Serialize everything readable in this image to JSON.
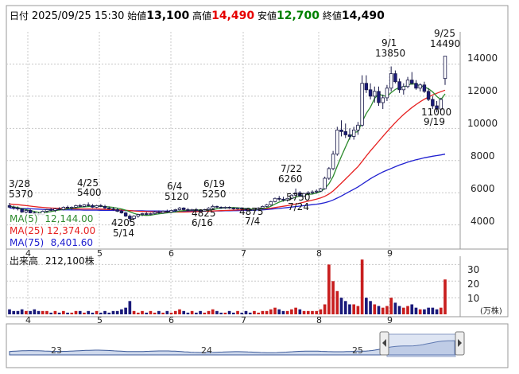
{
  "header": {
    "date_label": "日付",
    "datetime": "2025/09/25 15:30",
    "open_label": "始値",
    "open_value": "13,100",
    "high_label": "高値",
    "high_value": "14,490",
    "low_label": "安値",
    "low_value": "12,700",
    "close_label": "終値",
    "close_value": "14,490"
  },
  "colors": {
    "up": "#ffffff",
    "down": "#1a1a7a",
    "ma5": "#2e8b2e",
    "ma25": "#e62020",
    "ma75": "#2020d0",
    "volume": "#c81e1e",
    "grid": "#c8c8c8"
  },
  "legend": {
    "ma5_label": "MA(5)",
    "ma5_value": "12,144.00",
    "ma25_label": "MA(25)",
    "ma25_value": "12,374.00",
    "ma75_label": "MA(75)",
    "ma75_value": "8,401.60"
  },
  "volume_panel": {
    "label": "出来高",
    "value": "212,100株",
    "unit": "(万株)",
    "ticks": [
      "30",
      "20",
      "10"
    ]
  },
  "price_ticks": [
    "14000",
    "12000",
    "10000",
    "8000",
    "6000",
    "4000"
  ],
  "month_labels": [
    "4",
    "5",
    "6",
    "7",
    "8",
    "9"
  ],
  "navigator": {
    "labels": [
      "23",
      "24",
      "25"
    ]
  },
  "annotations": [
    {
      "date": "3/28",
      "value": "5370"
    },
    {
      "date": "4/25",
      "value": "5400"
    },
    {
      "date": "5/14",
      "value": "4205"
    },
    {
      "date": "6/4",
      "value": "5120"
    },
    {
      "date": "6/16",
      "value": "4825"
    },
    {
      "date": "6/19",
      "value": "5250"
    },
    {
      "date": "7/4",
      "value": "4875"
    },
    {
      "date": "7/22",
      "value": "6260"
    },
    {
      "date": "7/24",
      "value": "5750"
    },
    {
      "date": "9/1",
      "value": "13850"
    },
    {
      "date": "9/19",
      "value": "11000"
    },
    {
      "date": "9/25",
      "value": "14490"
    }
  ],
  "chart_data": {
    "type": "candlestick",
    "ylim": [
      2500,
      16000
    ],
    "volume_ylim": [
      0,
      35
    ],
    "candles": [
      {
        "o": 5200,
        "h": 5370,
        "l": 5050,
        "c": 5100,
        "v": 3
      },
      {
        "o": 5100,
        "h": 5200,
        "l": 4950,
        "c": 5050,
        "v": 2
      },
      {
        "o": 5050,
        "h": 5150,
        "l": 4900,
        "c": 5000,
        "v": 2
      },
      {
        "o": 5000,
        "h": 5050,
        "l": 4750,
        "c": 4800,
        "v": 3
      },
      {
        "o": 4800,
        "h": 4950,
        "l": 4650,
        "c": 4900,
        "v": 2
      },
      {
        "o": 4900,
        "h": 5000,
        "l": 4700,
        "c": 4750,
        "v": 2
      },
      {
        "o": 4750,
        "h": 4850,
        "l": 4600,
        "c": 4700,
        "v": 3
      },
      {
        "o": 4700,
        "h": 4800,
        "l": 4550,
        "c": 4650,
        "v": 2
      },
      {
        "o": 4650,
        "h": 4900,
        "l": 4600,
        "c": 4850,
        "v": 2
      },
      {
        "o": 4850,
        "h": 5000,
        "l": 4750,
        "c": 4950,
        "v": 2
      },
      {
        "o": 4950,
        "h": 5050,
        "l": 4850,
        "c": 4900,
        "v": 1
      },
      {
        "o": 4900,
        "h": 5050,
        "l": 4800,
        "c": 5000,
        "v": 2
      },
      {
        "o": 5000,
        "h": 5100,
        "l": 4900,
        "c": 4950,
        "v": 1
      },
      {
        "o": 4950,
        "h": 5150,
        "l": 4900,
        "c": 5100,
        "v": 2
      },
      {
        "o": 5100,
        "h": 5200,
        "l": 5000,
        "c": 5050,
        "v": 1
      },
      {
        "o": 5050,
        "h": 5150,
        "l": 4950,
        "c": 5100,
        "v": 1
      },
      {
        "o": 5100,
        "h": 5250,
        "l": 5050,
        "c": 5200,
        "v": 2
      },
      {
        "o": 5200,
        "h": 5300,
        "l": 5100,
        "c": 5150,
        "v": 2
      },
      {
        "o": 5150,
        "h": 5300,
        "l": 5100,
        "c": 5250,
        "v": 1
      },
      {
        "o": 5250,
        "h": 5400,
        "l": 5150,
        "c": 5200,
        "v": 2
      },
      {
        "o": 5200,
        "h": 5300,
        "l": 5050,
        "c": 5100,
        "v": 1
      },
      {
        "o": 5100,
        "h": 5250,
        "l": 5050,
        "c": 5200,
        "v": 2
      },
      {
        "o": 5200,
        "h": 5300,
        "l": 5100,
        "c": 5150,
        "v": 1
      },
      {
        "o": 5150,
        "h": 5250,
        "l": 5000,
        "c": 5050,
        "v": 2
      },
      {
        "o": 5050,
        "h": 5150,
        "l": 4950,
        "c": 5000,
        "v": 1
      },
      {
        "o": 5000,
        "h": 5100,
        "l": 4900,
        "c": 4950,
        "v": 2
      },
      {
        "o": 4950,
        "h": 5050,
        "l": 4800,
        "c": 4850,
        "v": 2
      },
      {
        "o": 4850,
        "h": 4950,
        "l": 4700,
        "c": 4750,
        "v": 3
      },
      {
        "o": 4750,
        "h": 4800,
        "l": 4500,
        "c": 4550,
        "v": 4
      },
      {
        "o": 4550,
        "h": 4650,
        "l": 4205,
        "c": 4400,
        "v": 8
      },
      {
        "o": 4400,
        "h": 4600,
        "l": 4300,
        "c": 4550,
        "v": 2
      },
      {
        "o": 4550,
        "h": 4700,
        "l": 4450,
        "c": 4650,
        "v": 1
      },
      {
        "o": 4650,
        "h": 4750,
        "l": 4550,
        "c": 4700,
        "v": 2
      },
      {
        "o": 4700,
        "h": 4800,
        "l": 4600,
        "c": 4650,
        "v": 1
      },
      {
        "o": 4650,
        "h": 4750,
        "l": 4600,
        "c": 4700,
        "v": 2
      },
      {
        "o": 4700,
        "h": 4850,
        "l": 4650,
        "c": 4800,
        "v": 1
      },
      {
        "o": 4800,
        "h": 4900,
        "l": 4700,
        "c": 4750,
        "v": 2
      },
      {
        "o": 4750,
        "h": 4900,
        "l": 4700,
        "c": 4850,
        "v": 1
      },
      {
        "o": 4850,
        "h": 4950,
        "l": 4750,
        "c": 4800,
        "v": 2
      },
      {
        "o": 4800,
        "h": 4950,
        "l": 4750,
        "c": 4900,
        "v": 1
      },
      {
        "o": 4900,
        "h": 5000,
        "l": 4800,
        "c": 4950,
        "v": 2
      },
      {
        "o": 4950,
        "h": 5120,
        "l": 4900,
        "c": 5050,
        "v": 3
      },
      {
        "o": 5050,
        "h": 5100,
        "l": 4900,
        "c": 4950,
        "v": 2
      },
      {
        "o": 4950,
        "h": 5050,
        "l": 4850,
        "c": 4900,
        "v": 1
      },
      {
        "o": 4900,
        "h": 5000,
        "l": 4850,
        "c": 4950,
        "v": 2
      },
      {
        "o": 4950,
        "h": 5050,
        "l": 4850,
        "c": 4900,
        "v": 1
      },
      {
        "o": 4900,
        "h": 4950,
        "l": 4825,
        "c": 4850,
        "v": 2
      },
      {
        "o": 4850,
        "h": 5000,
        "l": 4825,
        "c": 4950,
        "v": 1
      },
      {
        "o": 4950,
        "h": 5100,
        "l": 4900,
        "c": 5050,
        "v": 2
      },
      {
        "o": 5050,
        "h": 5250,
        "l": 5000,
        "c": 5150,
        "v": 3
      },
      {
        "o": 5150,
        "h": 5200,
        "l": 5050,
        "c": 5100,
        "v": 2
      },
      {
        "o": 5100,
        "h": 5150,
        "l": 5000,
        "c": 5050,
        "v": 1
      },
      {
        "o": 5050,
        "h": 5150,
        "l": 5000,
        "c": 5100,
        "v": 1
      },
      {
        "o": 5100,
        "h": 5150,
        "l": 5000,
        "c": 5050,
        "v": 2
      },
      {
        "o": 5050,
        "h": 5100,
        "l": 4950,
        "c": 5000,
        "v": 1
      },
      {
        "o": 5000,
        "h": 5100,
        "l": 4950,
        "c": 5050,
        "v": 2
      },
      {
        "o": 5050,
        "h": 5100,
        "l": 4950,
        "c": 5000,
        "v": 1
      },
      {
        "o": 5000,
        "h": 5050,
        "l": 4900,
        "c": 4950,
        "v": 2
      },
      {
        "o": 4950,
        "h": 5000,
        "l": 4875,
        "c": 4900,
        "v": 1
      },
      {
        "o": 4900,
        "h": 5000,
        "l": 4875,
        "c": 4950,
        "v": 2
      },
      {
        "o": 4950,
        "h": 5100,
        "l": 4900,
        "c": 5050,
        "v": 1
      },
      {
        "o": 5050,
        "h": 5200,
        "l": 5000,
        "c": 5150,
        "v": 2
      },
      {
        "o": 5150,
        "h": 5300,
        "l": 5100,
        "c": 5250,
        "v": 2
      },
      {
        "o": 5250,
        "h": 5500,
        "l": 5200,
        "c": 5450,
        "v": 3
      },
      {
        "o": 5450,
        "h": 5700,
        "l": 5400,
        "c": 5650,
        "v": 4
      },
      {
        "o": 5650,
        "h": 5800,
        "l": 5500,
        "c": 5600,
        "v": 3
      },
      {
        "o": 5600,
        "h": 5750,
        "l": 5450,
        "c": 5550,
        "v": 2
      },
      {
        "o": 5550,
        "h": 5700,
        "l": 5450,
        "c": 5650,
        "v": 2
      },
      {
        "o": 5650,
        "h": 5900,
        "l": 5600,
        "c": 5850,
        "v": 3
      },
      {
        "o": 5850,
        "h": 6260,
        "l": 5800,
        "c": 6000,
        "v": 4
      },
      {
        "o": 6000,
        "h": 6100,
        "l": 5750,
        "c": 5800,
        "v": 3
      },
      {
        "o": 5800,
        "h": 6000,
        "l": 5750,
        "c": 5950,
        "v": 2
      },
      {
        "o": 5950,
        "h": 6100,
        "l": 5850,
        "c": 6000,
        "v": 2
      },
      {
        "o": 6000,
        "h": 6150,
        "l": 5900,
        "c": 6050,
        "v": 2
      },
      {
        "o": 6050,
        "h": 6200,
        "l": 5950,
        "c": 6100,
        "v": 2
      },
      {
        "o": 6100,
        "h": 6300,
        "l": 6050,
        "c": 6250,
        "v": 3
      },
      {
        "o": 6250,
        "h": 7000,
        "l": 6200,
        "c": 6900,
        "v": 6
      },
      {
        "o": 6900,
        "h": 7600,
        "l": 6800,
        "c": 7500,
        "v": 30
      },
      {
        "o": 7500,
        "h": 8600,
        "l": 7400,
        "c": 8400,
        "v": 20
      },
      {
        "o": 8400,
        "h": 10100,
        "l": 8300,
        "c": 9900,
        "v": 14
      },
      {
        "o": 9900,
        "h": 10500,
        "l": 9500,
        "c": 9800,
        "v": 10
      },
      {
        "o": 9800,
        "h": 10300,
        "l": 9400,
        "c": 9600,
        "v": 8
      },
      {
        "o": 9600,
        "h": 10000,
        "l": 9300,
        "c": 9500,
        "v": 6
      },
      {
        "o": 9500,
        "h": 10100,
        "l": 9300,
        "c": 9900,
        "v": 6
      },
      {
        "o": 9900,
        "h": 10400,
        "l": 9600,
        "c": 10200,
        "v": 5
      },
      {
        "o": 10200,
        "h": 13300,
        "l": 10100,
        "c": 12800,
        "v": 33
      },
      {
        "o": 12800,
        "h": 13300,
        "l": 12200,
        "c": 12400,
        "v": 10
      },
      {
        "o": 12400,
        "h": 12800,
        "l": 11800,
        "c": 12000,
        "v": 8
      },
      {
        "o": 12000,
        "h": 12600,
        "l": 11600,
        "c": 12300,
        "v": 6
      },
      {
        "o": 12300,
        "h": 12600,
        "l": 11400,
        "c": 11600,
        "v": 5
      },
      {
        "o": 11600,
        "h": 12100,
        "l": 11200,
        "c": 11900,
        "v": 4
      },
      {
        "o": 11900,
        "h": 12700,
        "l": 11700,
        "c": 12500,
        "v": 5
      },
      {
        "o": 12500,
        "h": 13850,
        "l": 12300,
        "c": 13400,
        "v": 10
      },
      {
        "o": 13400,
        "h": 13600,
        "l": 12800,
        "c": 12900,
        "v": 7
      },
      {
        "o": 12900,
        "h": 13100,
        "l": 12200,
        "c": 12400,
        "v": 5
      },
      {
        "o": 12400,
        "h": 12800,
        "l": 12100,
        "c": 12600,
        "v": 4
      },
      {
        "o": 12600,
        "h": 13200,
        "l": 12500,
        "c": 13000,
        "v": 5
      },
      {
        "o": 13000,
        "h": 13500,
        "l": 12700,
        "c": 12800,
        "v": 6
      },
      {
        "o": 12800,
        "h": 13000,
        "l": 12400,
        "c": 12500,
        "v": 4
      },
      {
        "o": 12500,
        "h": 12800,
        "l": 12300,
        "c": 12700,
        "v": 3
      },
      {
        "o": 12700,
        "h": 12900,
        "l": 12200,
        "c": 12300,
        "v": 3
      },
      {
        "o": 12300,
        "h": 12500,
        "l": 11700,
        "c": 11800,
        "v": 4
      },
      {
        "o": 11800,
        "h": 12000,
        "l": 11200,
        "c": 11400,
        "v": 4
      },
      {
        "o": 11400,
        "h": 11700,
        "l": 11000,
        "c": 11200,
        "v": 3
      },
      {
        "o": 11200,
        "h": 11900,
        "l": 11100,
        "c": 11800,
        "v": 4
      },
      {
        "o": 13100,
        "h": 14490,
        "l": 12700,
        "c": 14490,
        "v": 21
      }
    ],
    "ma5": [
      5150,
      5120,
      5080,
      5010,
      4950,
      4890,
      4840,
      4780,
      4760,
      4790,
      4830,
      4880,
      4930,
      4960,
      4990,
      5030,
      5060,
      5100,
      5120,
      5140,
      5160,
      5170,
      5150,
      5140,
      5120,
      5090,
      5040,
      4990,
      4920,
      4820,
      4720,
      4640,
      4610,
      4590,
      4600,
      4650,
      4690,
      4720,
      4750,
      4780,
      4810,
      4860,
      4890,
      4900,
      4920,
      4940,
      4920,
      4910,
      4920,
      4960,
      5000,
      5040,
      5060,
      5070,
      5080,
      5060,
      5040,
      5020,
      4990,
      4970,
      4970,
      5000,
      5060,
      5160,
      5300,
      5420,
      5500,
      5570,
      5640,
      5730,
      5800,
      5850,
      5900,
      5920,
      5980,
      6070,
      6260,
      6560,
      7010,
      7660,
      8260,
      8840,
      9420,
      9740,
      9800,
      10400,
      10920,
      11320,
      11860,
      12140,
      12040,
      11980,
      12220,
      12420,
      12560,
      12560,
      12680,
      12780,
      12720,
      12660,
      12580,
      12460,
      12270,
      11990,
      11780,
      12144
    ],
    "ma25": [
      5300,
      5280,
      5260,
      5230,
      5200,
      5170,
      5140,
      5110,
      5090,
      5070,
      5050,
      5040,
      5030,
      5020,
      5010,
      5000,
      4990,
      4990,
      4990,
      4990,
      4990,
      4990,
      4980,
      4970,
      4960,
      4950,
      4940,
      4930,
      4910,
      4890,
      4870,
      4850,
      4840,
      4830,
      4820,
      4810,
      4800,
      4800,
      4800,
      4800,
      4800,
      4800,
      4800,
      4810,
      4820,
      4830,
      4840,
      4850,
      4860,
      4870,
      4880,
      4890,
      4900,
      4910,
      4920,
      4930,
      4940,
      4950,
      4960,
      4970,
      4980,
      4990,
      5010,
      5040,
      5080,
      5120,
      5160,
      5200,
      5250,
      5300,
      5360,
      5420,
      5480,
      5540,
      5600,
      5680,
      5780,
      5920,
      6110,
      6350,
      6600,
      6850,
      7110,
      7370,
      7620,
      7950,
      8280,
      8600,
      8900,
      9200,
      9500,
      9790,
      10080,
      10360,
      10620,
      10860,
      11080,
      11290,
      11480,
      11660,
      11810,
      11950,
      12080,
      12180,
      12280,
      12374
    ],
    "ma75": [
      5050,
      5040,
      5030,
      5020,
      5010,
      5000,
      4990,
      4980,
      4970,
      4960,
      4960,
      4950,
      4950,
      4940,
      4940,
      4930,
      4930,
      4930,
      4920,
      4920,
      4920,
      4920,
      4910,
      4910,
      4910,
      4900,
      4900,
      4900,
      4890,
      4890,
      4880,
      4880,
      4880,
      4870,
      4870,
      4870,
      4870,
      4860,
      4860,
      4860,
      4860,
      4860,
      4860,
      4860,
      4860,
      4860,
      4860,
      4860,
      4860,
      4870,
      4870,
      4870,
      4880,
      4880,
      4890,
      4890,
      4900,
      4900,
      4910,
      4920,
      4930,
      4940,
      4960,
      4980,
      5000,
      5020,
      5050,
      5080,
      5110,
      5140,
      5170,
      5200,
      5230,
      5260,
      5290,
      5330,
      5380,
      5450,
      5550,
      5670,
      5800,
      5940,
      6080,
      6220,
      6360,
      6530,
      6700,
      6870,
      7020,
      7160,
      7290,
      7400,
      7510,
      7620,
      7720,
      7810,
      7900,
      7980,
      8050,
      8110,
      8170,
      8220,
      8270,
      8310,
      8350,
      8401.6
    ]
  }
}
